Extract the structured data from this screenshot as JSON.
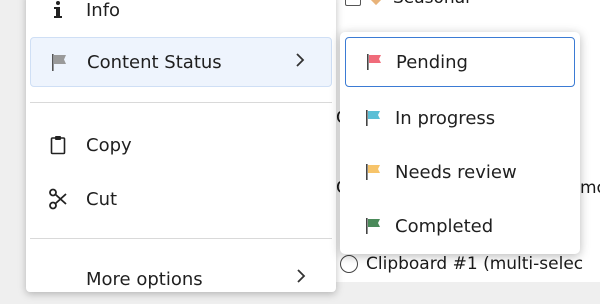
{
  "background": {
    "top_row_label": "Seasonal",
    "peek_a": "C",
    "peek_b": "mo",
    "peek_c": "C",
    "bottom_row_label": "Clipboard #1 (multi-selec"
  },
  "context_menu": {
    "items": [
      {
        "label": "Info",
        "icon": "info-icon"
      },
      {
        "label": "Content Status",
        "icon": "flag-icon"
      },
      {
        "label": "Copy",
        "icon": "clipboard-icon"
      },
      {
        "label": "Cut",
        "icon": "scissors-icon"
      },
      {
        "label": "More options",
        "icon": ""
      }
    ]
  },
  "submenu": {
    "items": [
      {
        "label": "Pending",
        "flag_color": "#f06b7a"
      },
      {
        "label": "In progress",
        "flag_color": "#5bbfd6"
      },
      {
        "label": "Needs review",
        "flag_color": "#f7c46a"
      },
      {
        "label": "Completed",
        "flag_color": "#4a8a5a"
      }
    ]
  },
  "colors": {
    "neutral_flag": "#9a9a9a",
    "active_border": "#3b7bd4",
    "active_bg": "#eef4fd"
  }
}
